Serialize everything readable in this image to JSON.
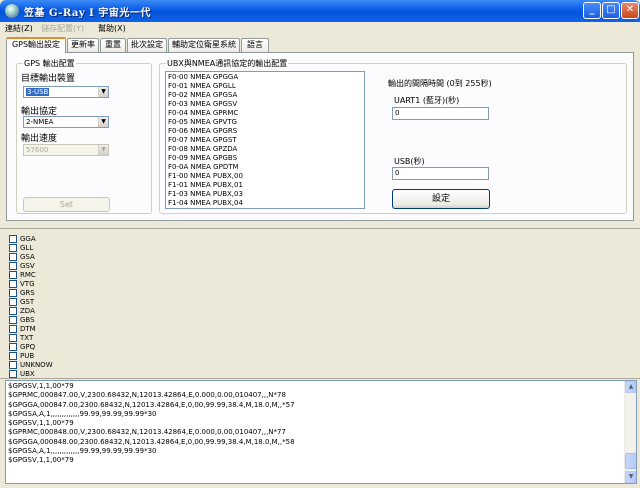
{
  "window": {
    "title": "笠基 G-Ray I 宇宙光一代",
    "min": "_",
    "max": "□",
    "close": "✕"
  },
  "menu": {
    "connect": "連結(Z)",
    "save": "儲存配置(Y)",
    "help": "幫助(X)"
  },
  "tabs": [
    "GPS輸出設定",
    "更新率",
    "重置",
    "批次設定",
    "輔助定位衛星系統",
    "語言"
  ],
  "gps_output": {
    "group_label": "GPS 輸出配置",
    "device_label": "目標輸出裝置",
    "device_value": "3-USB",
    "protocol_label": "輸出協定",
    "protocol_value": "2-NMEA",
    "speed_label": "輸出速度",
    "speed_value": "57600",
    "set_button": "Set"
  },
  "ubx": {
    "group_label": "UBX與NMEA通訊協定的輸出配置",
    "messages": [
      "F0-00 NMEA GPGGA",
      "F0-01 NMEA GPGLL",
      "F0-02 NMEA GPGSA",
      "F0-03 NMEA GPGSV",
      "F0-04 NMEA GPRMC",
      "F0-05 NMEA GPVTG",
      "F0-06 NMEA GPGRS",
      "F0-07 NMEA GPGST",
      "F0-08 NMEA GPZDA",
      "F0-09 NMEA GPGBS",
      "F0-0A NMEA GPDTM",
      "F1-00 NMEA PUBX,00",
      "F1-01 NMEA PUBX,01",
      "F1-03 NMEA PUBX,03",
      "F1-04 NMEA PUBX,04"
    ],
    "interval_label": "輸出的間隔時間 (0到 255秒)",
    "uart_label": "UART1 (藍牙)(秒)",
    "uart_value": "0",
    "usb_label": "USB(秒)",
    "usb_value": "0",
    "set_button": "設定"
  },
  "sentence_checks": [
    "GGA",
    "GLL",
    "GSA",
    "GSV",
    "RMC",
    "VTG",
    "GRS",
    "GST",
    "ZDA",
    "GBS",
    "DTM",
    "TXT",
    "GPQ",
    "PUB",
    "UNKNOW",
    "UBX"
  ],
  "log": [
    "$GPGSV,1,1,00*79",
    "$GPRMC,000847.00,V,2300.68432,N,12013.42864,E,0.000,0.00,010407,,,N*78",
    "$GPGGA,000847.00,2300.68432,N,12013.42864,E,0,00,99.99,38.4,M,18.0,M,,*57",
    "$GPGSA,A,1,,,,,,,,,,,,,99.99,99.99,99.99*30",
    "$GPGSV,1,1,00*79",
    "$GPRMC,000848.00,V,2300.68432,N,12013.42864,E,0.000,0.00,010407,,,N*77",
    "$GPGGA,000848.00,2300.68432,N,12013.42864,E,0,00,99.99,38.4,M,18.0,M,,*58",
    "$GPGSA,A,1,,,,,,,,,,,,,99.99,99.99,99.99*30",
    "$GPGSV,1,1,00*79"
  ],
  "colors": {
    "titlebar": "#0553d8",
    "active_tab": "#e68b2c",
    "selection": "#316ac5"
  }
}
